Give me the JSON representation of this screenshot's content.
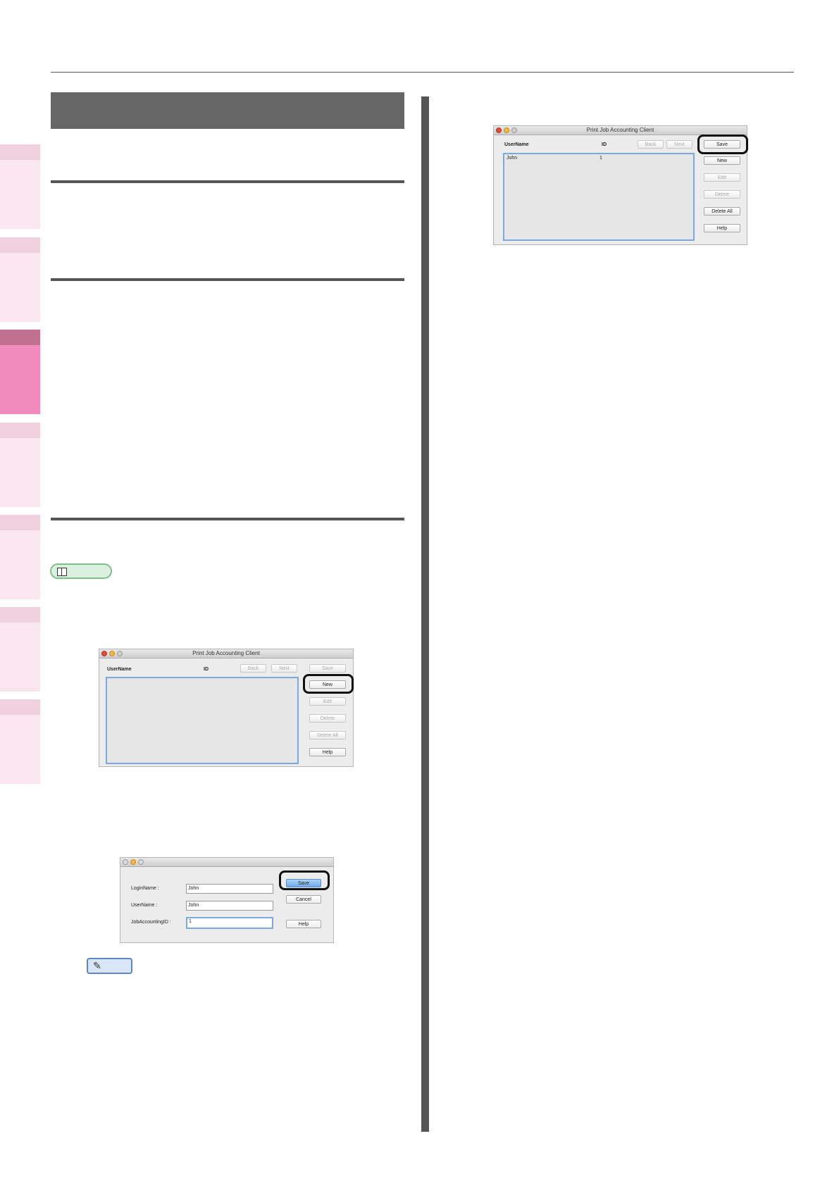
{
  "window1": {
    "title": "Print Job Accounting Client",
    "col_username": "UserName",
    "col_id": "ID",
    "buttons": {
      "back": "Back",
      "next": "Next",
      "save": "Save",
      "new": "New",
      "edit": "Edit",
      "delete": "Delete",
      "delete_all": "Delete All",
      "help": "Help"
    }
  },
  "window2": {
    "login_label": "LoginName :",
    "login_value": "John",
    "username_label": "UserName :",
    "username_value": "John",
    "id_label": "JobAccountingID :",
    "id_value": "1",
    "buttons": {
      "save": "Save",
      "cancel": "Cancel",
      "help": "Help"
    }
  },
  "window3": {
    "title": "Print Job Accounting Client",
    "col_username": "UserName",
    "col_id": "ID",
    "row": {
      "username": "John",
      "id": "1"
    },
    "buttons": {
      "back": "Back",
      "next": "Next",
      "save": "Save",
      "new": "New",
      "edit": "Edit",
      "delete": "Delete",
      "delete_all": "Delete All",
      "help": "Help"
    }
  },
  "colors": {
    "active_tab": "#f28bbd",
    "inactive_tab": "#fae6ef",
    "section_bar": "#666666",
    "highlight": "#111111"
  }
}
